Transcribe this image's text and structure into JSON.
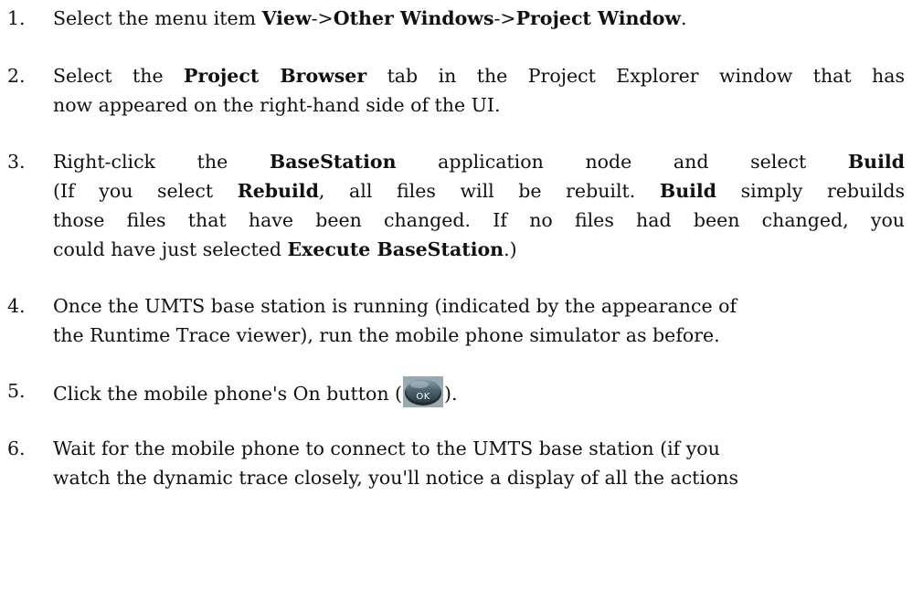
{
  "steps": [
    {
      "number": "1.",
      "lines": [
        [
          {
            "t": "Select the menu item ",
            "b": false
          },
          {
            "t": "View",
            "b": true
          },
          {
            "t": "->",
            "b": false
          },
          {
            "t": "Other Windows",
            "b": true
          },
          {
            "t": "->",
            "b": false
          },
          {
            "t": "Project Window",
            "b": true
          },
          {
            "t": ".",
            "b": false
          }
        ]
      ]
    },
    {
      "number": "2.",
      "lines": [
        [
          {
            "t": "Select the ",
            "b": false
          },
          {
            "t": "Project Browser",
            "b": true
          },
          {
            "t": " tab in the Project Explorer window that has",
            "b": false
          }
        ],
        [
          {
            "t": "now appeared on the right-hand side of the UI.",
            "b": false
          }
        ]
      ]
    },
    {
      "number": "3.",
      "lines": [
        [
          {
            "t": "Right-click the ",
            "b": false
          },
          {
            "t": "BaseStation",
            "b": true
          },
          {
            "t": " application node and select ",
            "b": false
          },
          {
            "t": "Build",
            "b": true
          }
        ],
        [
          {
            "t": " (If you select ",
            "b": false
          },
          {
            "t": "Rebuild",
            "b": true
          },
          {
            "t": ", all files will be rebuilt. ",
            "b": false
          },
          {
            "t": "Build",
            "b": true
          },
          {
            "t": " simply rebuilds",
            "b": false
          }
        ],
        [
          {
            "t": "those files that have been changed. If no files had been changed, you",
            "b": false
          }
        ],
        [
          {
            "t": "could have just selected ",
            "b": false
          },
          {
            "t": "Execute BaseStation",
            "b": true
          },
          {
            "t": ".)",
            "b": false
          }
        ]
      ]
    },
    {
      "number": "4.",
      "lines": [
        [
          {
            "t": "Once the UMTS base station is running (indicated by the appearance of",
            "b": false
          }
        ],
        [
          {
            "t": "the Runtime Trace viewer), run the mobile phone simulator as before.",
            "b": false
          }
        ]
      ]
    },
    {
      "number": "5.",
      "before_icon": "Click the mobile phone's On button (",
      "after_icon": ").",
      "icon": {
        "name": "ok-button-icon",
        "label": "OK"
      }
    },
    {
      "number": "6.",
      "lines": [
        [
          {
            "t": "Wait for the mobile phone to connect to the UMTS base station (if you",
            "b": false
          }
        ],
        [
          {
            "t": "watch the dynamic trace closely, you'll notice a display of all the actions",
            "b": false
          }
        ]
      ]
    }
  ]
}
